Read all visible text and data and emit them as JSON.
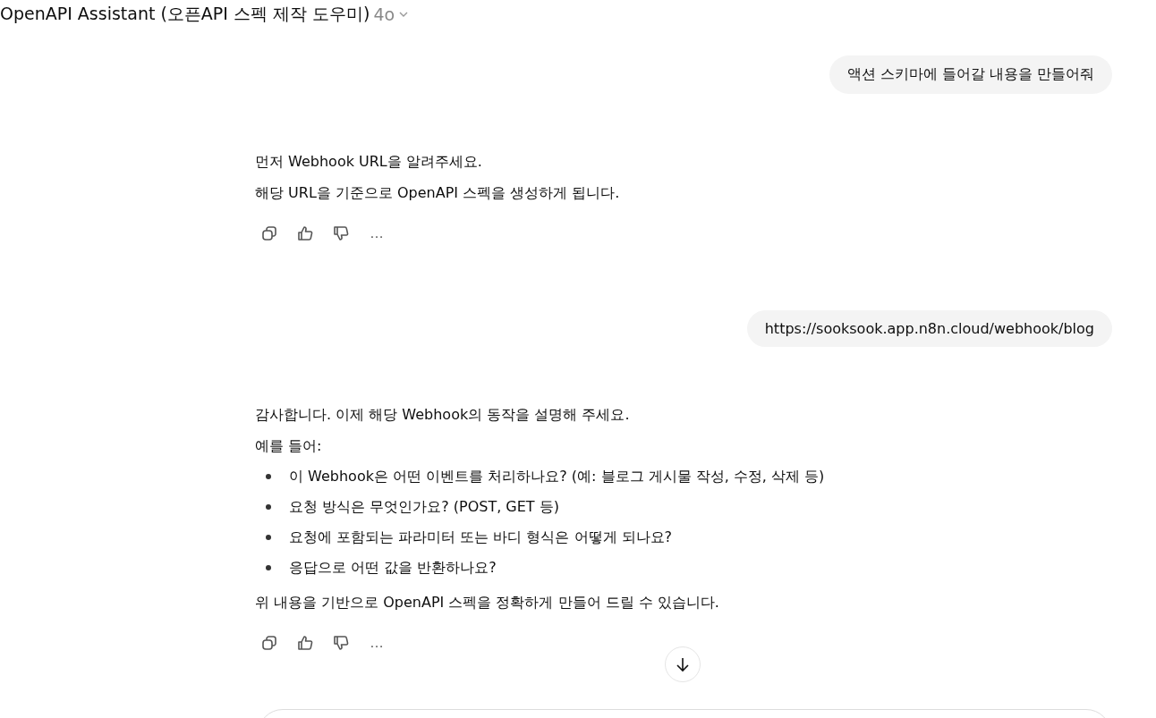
{
  "header": {
    "title": "OpenAPI Assistant (오픈API 스펙 제작 도우미)",
    "model": "4o"
  },
  "messages": [
    {
      "kind": "user",
      "text": "액션 스키마에 들어갈 내용을 만들어줘"
    },
    {
      "kind": "assistant",
      "blocks": [
        {
          "kind": "paragraph",
          "lines": [
            "먼저 Webhook URL을 알려주세요.",
            "해당 URL을 기준으로 OpenAPI 스펙을 생성하게 됩니다."
          ]
        }
      ],
      "actions": [
        "…"
      ]
    },
    {
      "kind": "user",
      "text": "https://sooksook.app.n8n.cloud/webhook/blog"
    },
    {
      "kind": "assistant",
      "blocks": [
        {
          "kind": "paragraph",
          "lines": [
            "감사합니다. 이제 해당 Webhook의 동작을 설명해 주세요.",
            "예를 들어:"
          ]
        },
        {
          "kind": "list",
          "items": [
            "이 Webhook은 어떤 이벤트를 처리하나요? (예: 블로그 게시물 작성, 수정, 삭제 등)",
            "요청 방식은 무엇인가요? (POST, GET 등)",
            "요청에 포함되는 파라미터 또는 바디 형식은 어떻게 되나요?",
            "응답으로 어떤 값을 반환하나요?"
          ]
        },
        {
          "kind": "paragraph",
          "lines": [
            "위 내용을 기반으로 OpenAPI 스펙을 정확하게 만들어 드릴 수 있습니다."
          ]
        }
      ],
      "actions": [
        "…"
      ]
    }
  ]
}
